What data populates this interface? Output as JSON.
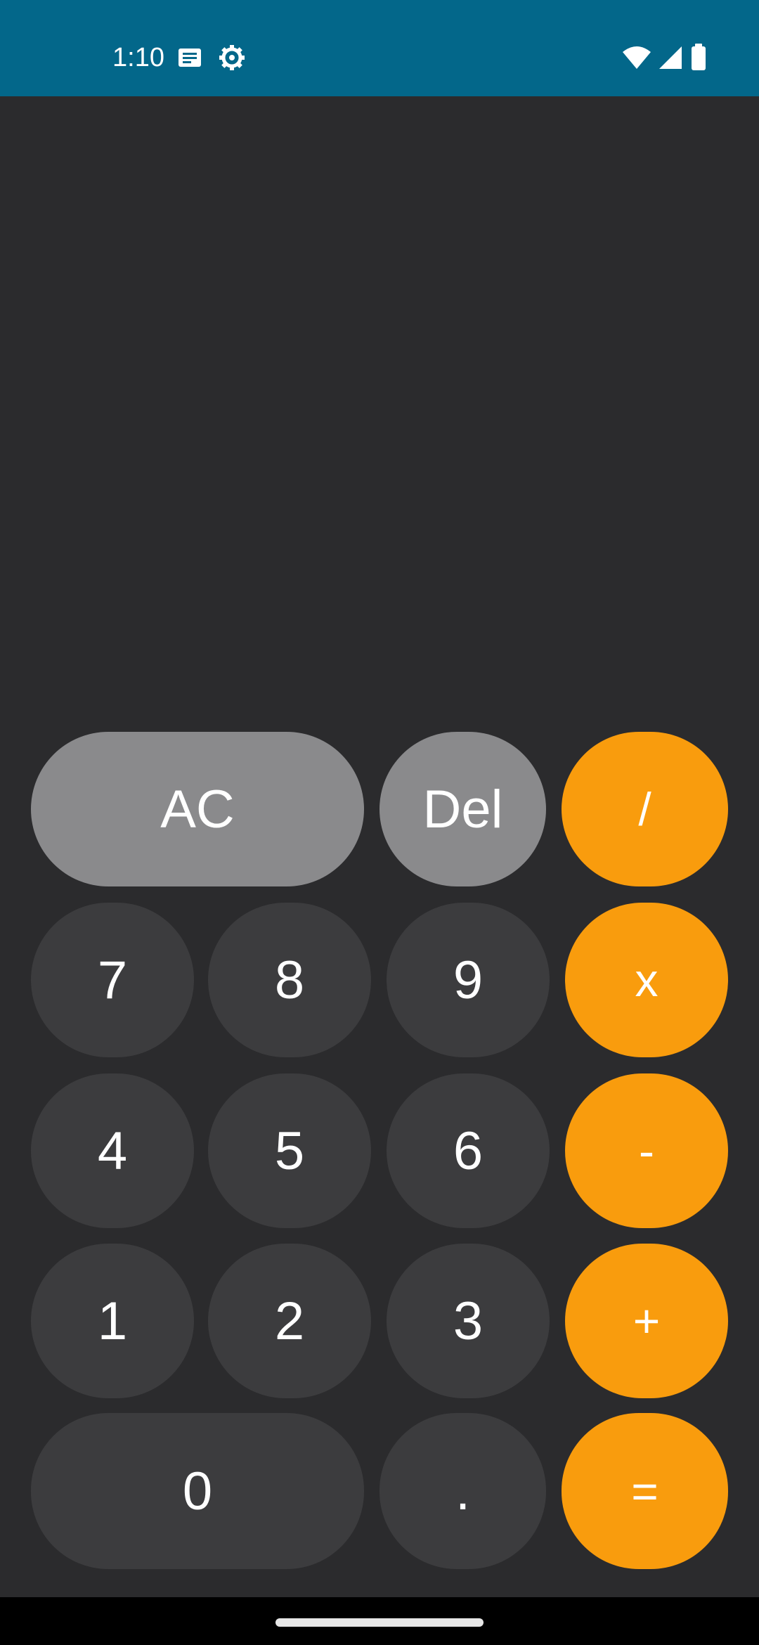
{
  "status_bar": {
    "time": "1:10",
    "icons": [
      "notification-icon",
      "settings-icon",
      "wifi-icon",
      "signal-icon",
      "battery-icon"
    ],
    "background": "#03678a"
  },
  "display": {
    "value": ""
  },
  "keypad": {
    "clear": "AC",
    "delete": "Del",
    "divide": "/",
    "multiply": "x",
    "subtract": "-",
    "add": "+",
    "equals": "=",
    "seven": "7",
    "eight": "8",
    "nine": "9",
    "four": "4",
    "five": "5",
    "six": "6",
    "one": "1",
    "two": "2",
    "three": "3",
    "zero": "0",
    "decimal": "."
  },
  "colors": {
    "background": "#2b2b2d",
    "function_key": "#8a8a8c",
    "digit_key": "#3c3c3e",
    "operator_key": "#f99c0d"
  }
}
